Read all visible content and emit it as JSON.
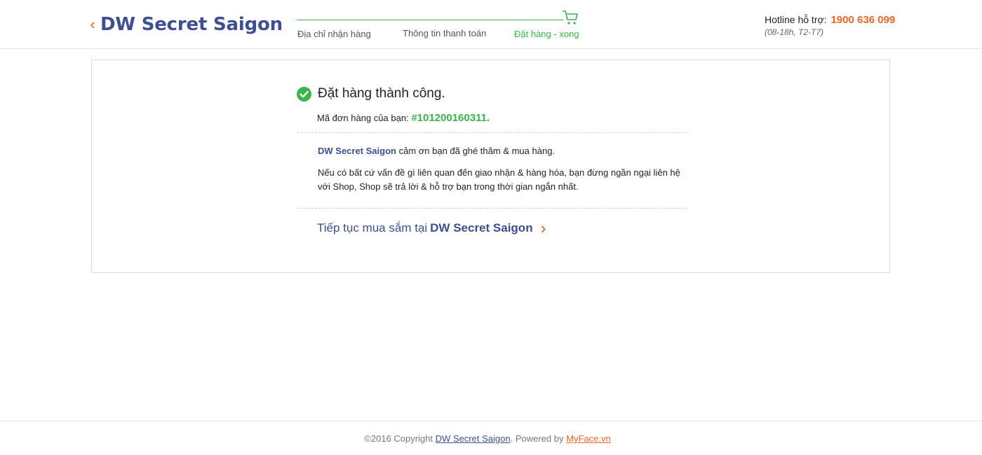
{
  "header": {
    "shop_name": "DW Secret Saigon",
    "back_icon": "chevron-left-icon",
    "steps": [
      {
        "label": "Địa chỉ nhận hàng",
        "state": "done"
      },
      {
        "label": "Thông tin thanh toán",
        "state": "done"
      },
      {
        "label": "Đặt hàng - xong",
        "state": "current"
      }
    ],
    "cart_icon": "cart-icon",
    "hotline_label": "Hotline hỗ trợ:",
    "hotline_number": "1900 636 099",
    "hotline_hours": "(08-18h, T2-T7)"
  },
  "confirmation": {
    "success_icon": "check-circle-icon",
    "title": "Đặt hàng thành công.",
    "order_label": "Mã đơn hàng của bạn:",
    "order_number": "#101200160311.",
    "thanks_brand": "DW Secret Saigon",
    "thanks_text": "cảm ơn bạn đã ghé thăm & mua hàng.",
    "support_text": "Nếu có bất cứ vấn đề gì liên quan đến giao nhận & hàng hóa, bạn đừng ngần ngại liên hệ với Shop, Shop sẽ trả lời & hỗ trợ bạn trong thời gian ngắn nhất.",
    "continue_text": "Tiếp tục mua sắm tại",
    "continue_brand": "DW Secret Saigon",
    "continue_icon": "chevron-right-icon"
  },
  "footer": {
    "copyright": "©2016 Copyright",
    "brand_link": "DW Secret Saigon",
    "powered_by": ". Powered by",
    "myface_link": "MyFace.vn"
  },
  "colors": {
    "brand_blue": "#3e4e96",
    "success_green": "#3bb54a",
    "accent_orange": "#f26522",
    "border": "#dcdcdc"
  }
}
